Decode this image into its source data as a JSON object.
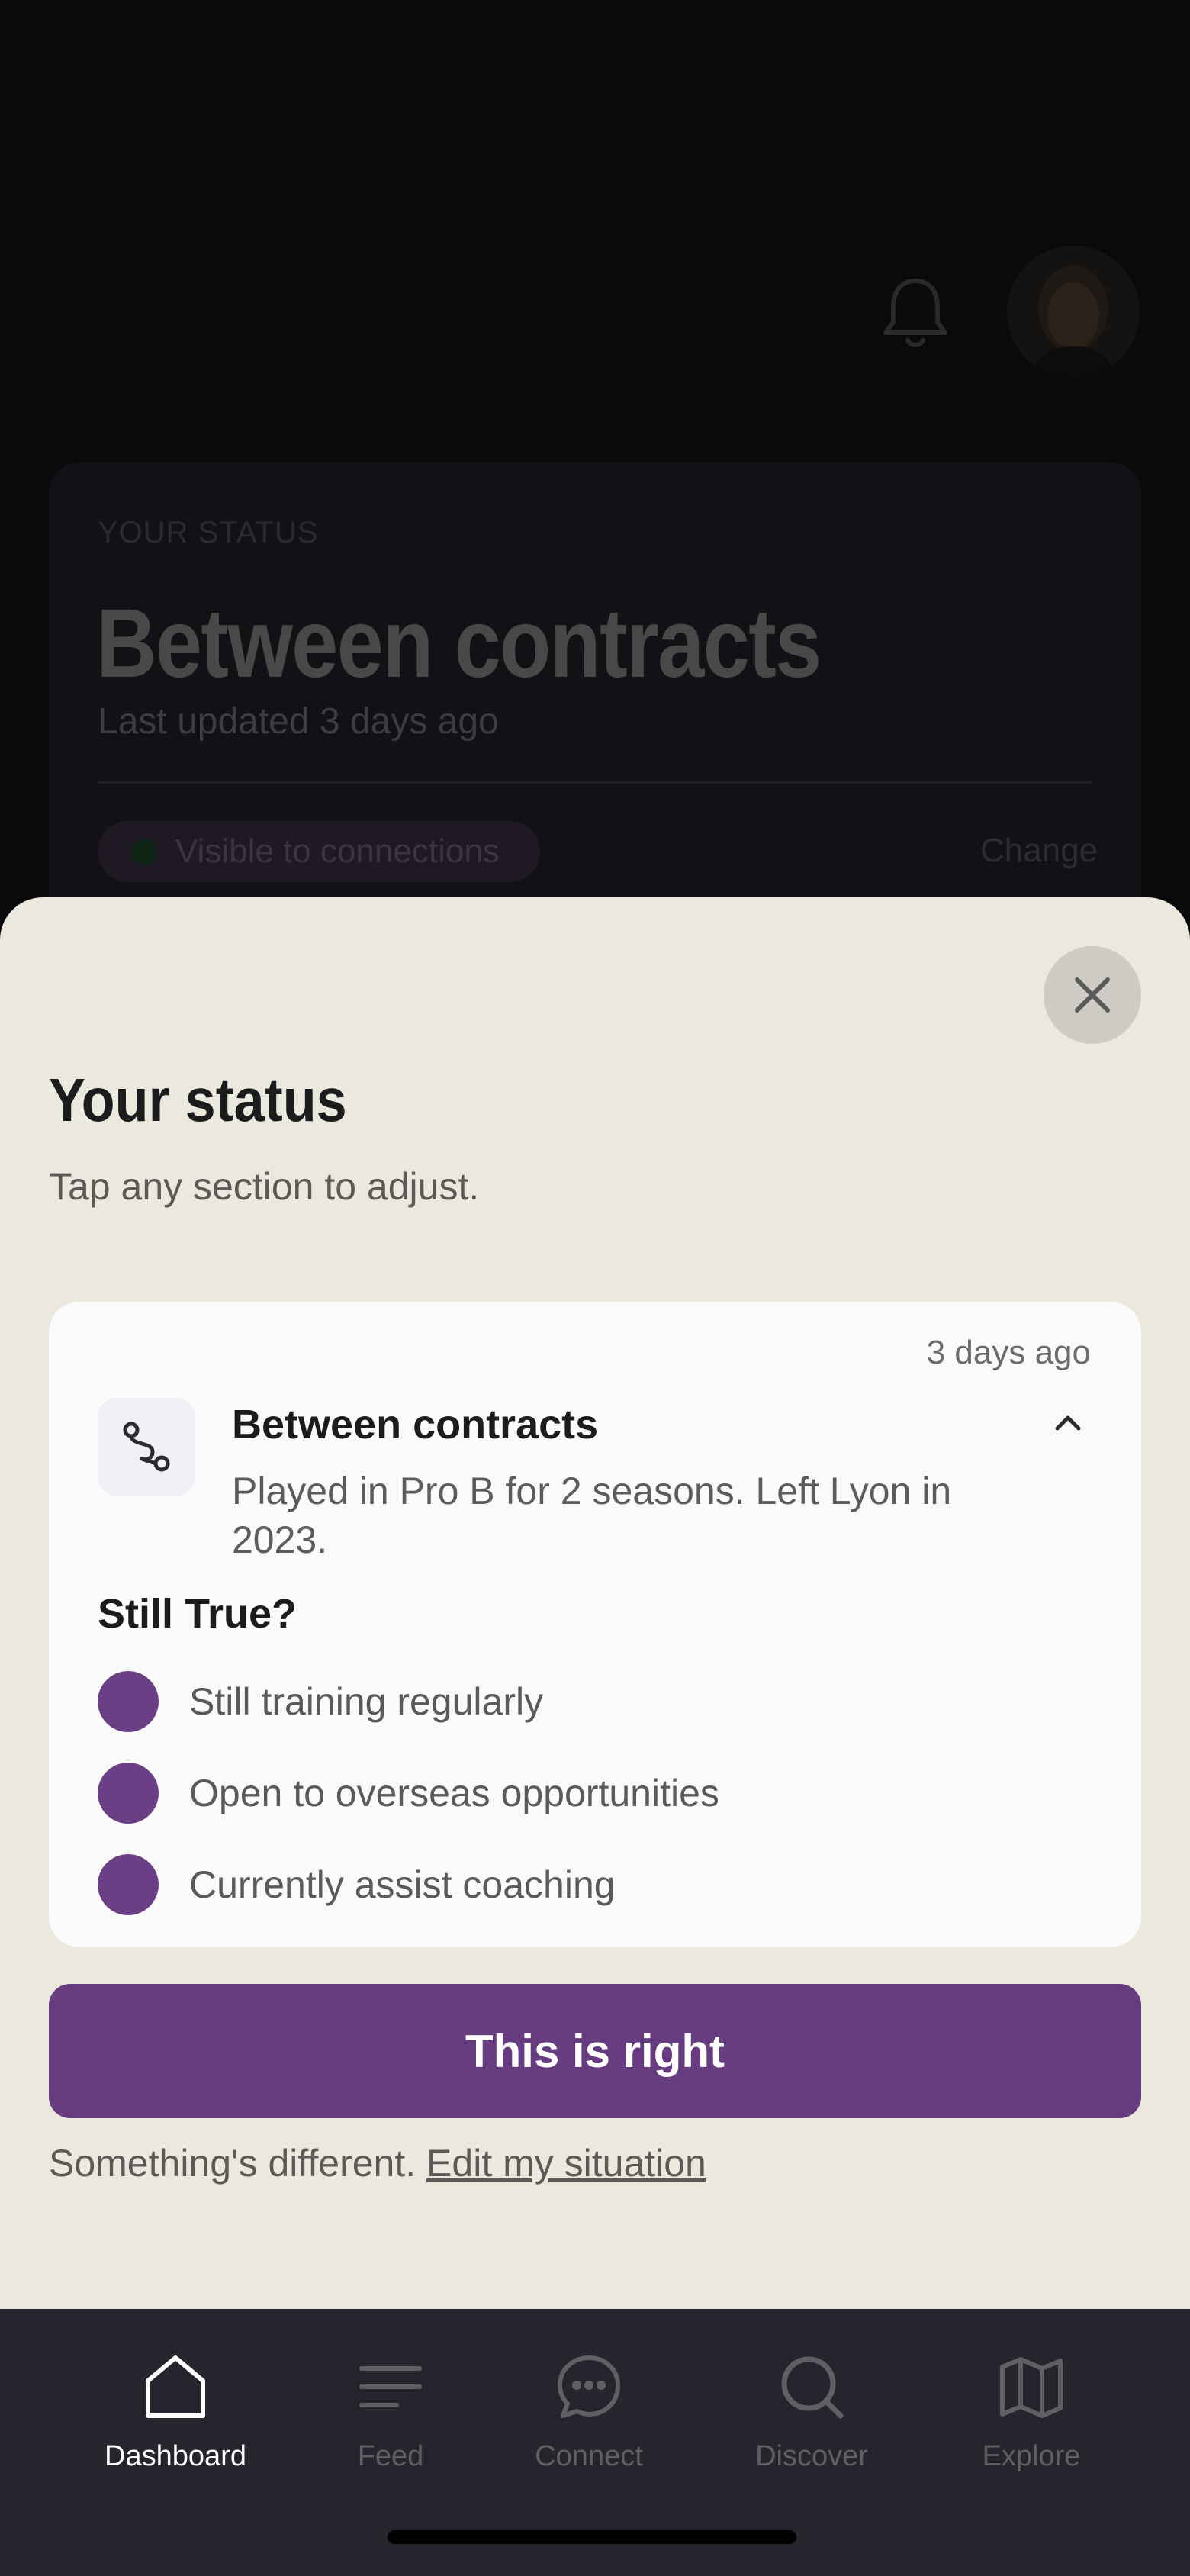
{
  "background_screen": {
    "notification_icon": "bell-icon",
    "avatar": "profile-photo",
    "status_card": {
      "eyebrow": "YOUR STATUS",
      "title": "Between contracts",
      "updated": "Last updated 3 days ago",
      "visibility": "Visible to connections",
      "change_label": "Change"
    }
  },
  "sheet": {
    "close_icon": "close-icon",
    "title": "Your status",
    "subtitle": "Tap any section to adjust.",
    "card": {
      "time_ago": "3 days ago",
      "icon": "route-icon",
      "title": "Between contracts",
      "description": "Played in Pro B for 2 seasons. Left Lyon in 2023.",
      "question": "Still True?",
      "options": [
        {
          "label": "Still training regularly"
        },
        {
          "label": "Open to overseas opportunities"
        },
        {
          "label": "Currently assist coaching"
        }
      ]
    },
    "confirm_label": "This is right",
    "footer_text": "Something's different.",
    "edit_link": "Edit my situation"
  },
  "nav": {
    "items": [
      {
        "label": "Dashboard",
        "icon": "home-icon",
        "active": true
      },
      {
        "label": "Feed",
        "icon": "feed-icon",
        "active": false
      },
      {
        "label": "Connect",
        "icon": "chat-icon",
        "active": false
      },
      {
        "label": "Discover",
        "icon": "search-icon",
        "active": false
      },
      {
        "label": "Explore",
        "icon": "map-icon",
        "active": false
      }
    ]
  },
  "colors": {
    "accent": "#663b80",
    "option_dot": "#6b3f86",
    "sheet_bg": "#ebe9de",
    "nav_bg": "#25252e"
  }
}
